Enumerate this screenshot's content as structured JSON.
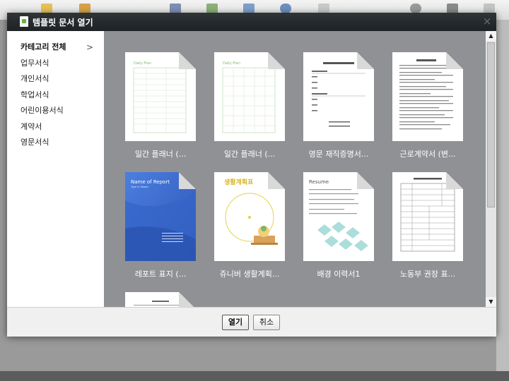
{
  "dialog": {
    "title": "템플릿 문서 열기",
    "close_glyph": "×"
  },
  "sidebar": {
    "items": [
      {
        "label": "카테고리 전체",
        "active": true
      },
      {
        "label": "업무서식"
      },
      {
        "label": "개인서식"
      },
      {
        "label": "학업서식"
      },
      {
        "label": "어린이용서식"
      },
      {
        "label": "계약서"
      },
      {
        "label": "영문서식"
      }
    ],
    "chevron": ">"
  },
  "templates": [
    {
      "label": "일간 플래너 (...",
      "thumb_title": "Daily Plan"
    },
    {
      "label": "일간 플래너 (...",
      "thumb_title": "Daily Plan"
    },
    {
      "label": "영문 재직증명서..."
    },
    {
      "label": "근로계약서 (변..."
    },
    {
      "label": "레포트 표지 (...",
      "thumb_title": "Name of Report",
      "thumb_subtitle": "Type in Report"
    },
    {
      "label": "쥬니버 생활계획...",
      "thumb_title": "생활계획표"
    },
    {
      "label": "배경 이력서1",
      "thumb_title": "Resume"
    },
    {
      "label": "노동부 권장 표..."
    },
    {
      "label": ""
    }
  ],
  "footer": {
    "open_label": "열기",
    "cancel_label": "취소"
  },
  "scrollbar": {
    "up_glyph": "▲",
    "down_glyph": "▼"
  },
  "colors": {
    "titlebar": "#23282b",
    "gallery_bg": "#8f9194",
    "report_blue": "#3f6fd1",
    "planner_green": "#9bcf8e",
    "resume_teal": "#8fd3cf"
  }
}
